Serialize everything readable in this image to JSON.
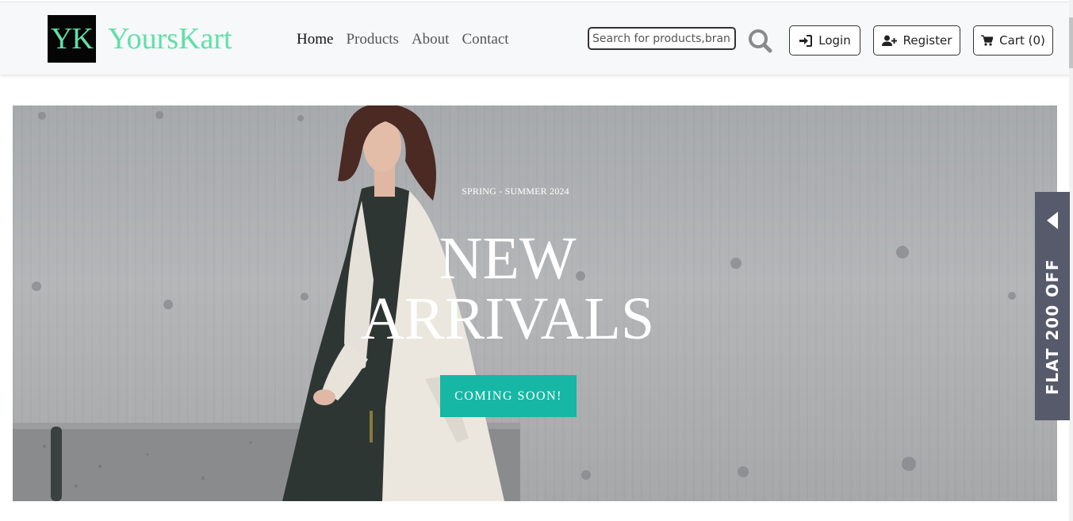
{
  "brand": {
    "logo_text": "YK",
    "name": "YoursKart",
    "color": "#5fe0a8"
  },
  "nav": {
    "links": [
      {
        "label": "Home",
        "active": true
      },
      {
        "label": "Products"
      },
      {
        "label": "About"
      },
      {
        "label": "Contact"
      }
    ]
  },
  "search": {
    "placeholder": "Search for products,brand",
    "icon": "search-icon"
  },
  "account": {
    "login_label": "Login",
    "login_icon": "sign-in-icon",
    "register_label": "Register",
    "register_icon": "user-plus-icon",
    "cart_label": "Cart (0)",
    "cart_icon": "cart-icon"
  },
  "hero": {
    "tag": "SPRING - SUMMER 2024",
    "title_line1": "NEW",
    "title_line2": "ARRIVALS",
    "button_label": "COMING SOON!",
    "button_color": "#16b7a4"
  },
  "offer_tab": {
    "label": "FLAT 200 OFF",
    "icon": "caret-left-icon",
    "color": "#565a6a"
  }
}
